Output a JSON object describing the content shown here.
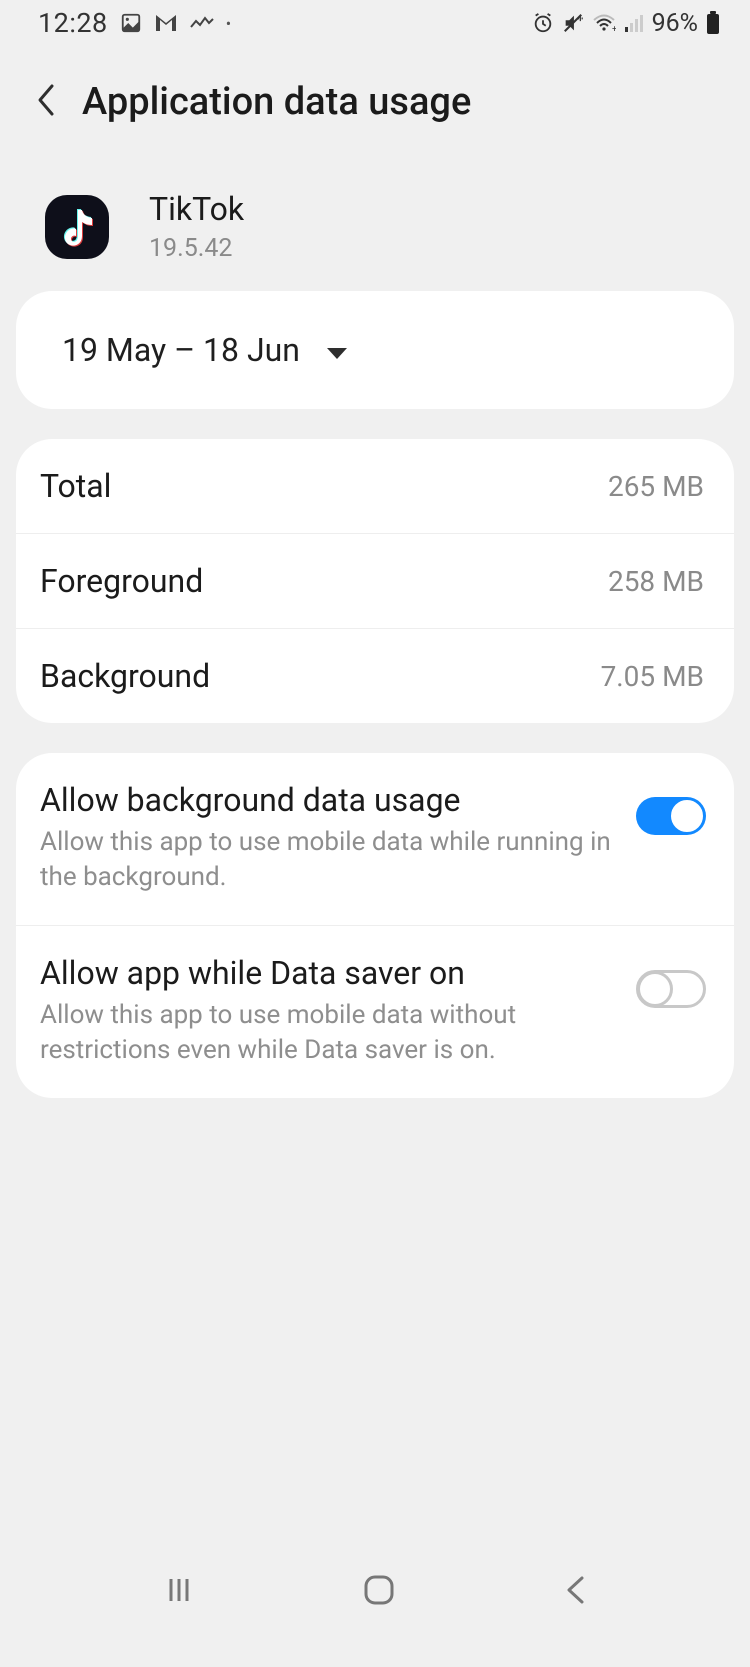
{
  "status": {
    "time": "12:28",
    "battery_pct": "96%"
  },
  "header": {
    "title": "Application data usage"
  },
  "app": {
    "name": "TikTok",
    "version": "19.5.42"
  },
  "period": {
    "range": "19 May – 18 Jun"
  },
  "usage": [
    {
      "label": "Total",
      "value": "265 MB"
    },
    {
      "label": "Foreground",
      "value": "258 MB"
    },
    {
      "label": "Background",
      "value": "7.05 MB"
    }
  ],
  "settings": {
    "bg_data": {
      "title": "Allow background data usage",
      "desc": "Allow this app to use mobile data while running in the background.",
      "on": true
    },
    "data_saver": {
      "title": "Allow app while Data saver on",
      "desc": "Allow this app to use mobile data without restrictions even while Data saver is on.",
      "on": false
    }
  }
}
